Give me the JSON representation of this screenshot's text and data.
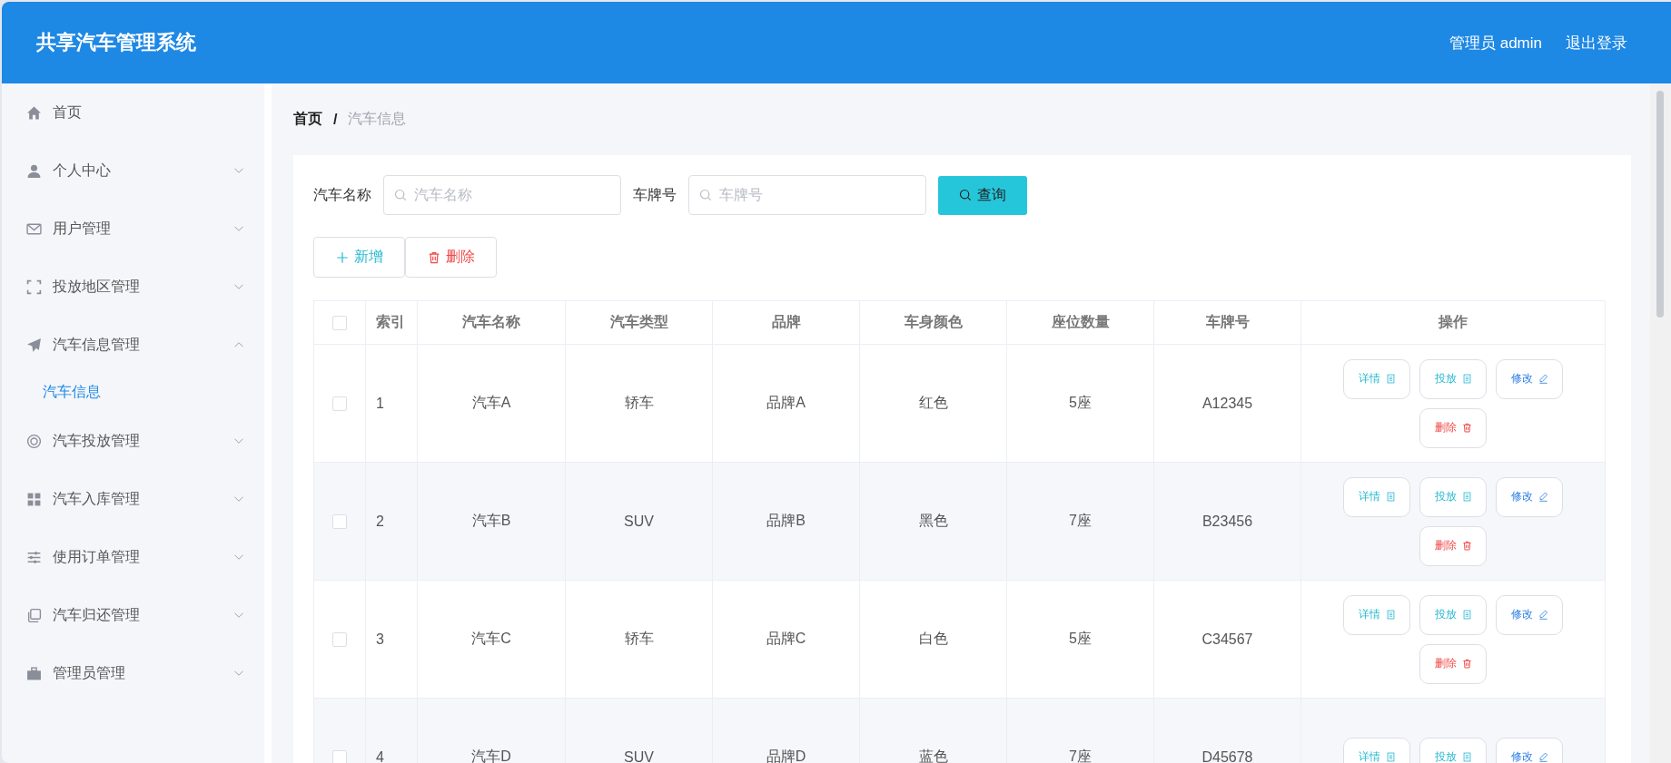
{
  "header": {
    "title": "共享汽车管理系统",
    "user": "管理员 admin",
    "logout": "退出登录"
  },
  "sidebar": {
    "items": [
      {
        "label": "首页",
        "kind": "link"
      },
      {
        "label": "个人中心",
        "kind": "menu",
        "expanded": false
      },
      {
        "label": "用户管理",
        "kind": "menu",
        "expanded": false
      },
      {
        "label": "投放地区管理",
        "kind": "menu",
        "expanded": false
      },
      {
        "label": "汽车信息管理",
        "kind": "menu",
        "expanded": true,
        "children": [
          {
            "label": "汽车信息",
            "selected": true
          }
        ]
      },
      {
        "label": "汽车投放管理",
        "kind": "menu",
        "expanded": false
      },
      {
        "label": "汽车入库管理",
        "kind": "menu",
        "expanded": false
      },
      {
        "label": "使用订单管理",
        "kind": "menu",
        "expanded": false
      },
      {
        "label": "汽车归还管理",
        "kind": "menu",
        "expanded": false
      },
      {
        "label": "管理员管理",
        "kind": "menu",
        "expanded": false
      }
    ]
  },
  "breadcrumb": {
    "items": [
      "首页",
      "汽车信息"
    ],
    "separator": "/"
  },
  "search": {
    "fields": [
      {
        "label": "汽车名称",
        "placeholder": "汽车名称"
      },
      {
        "label": "车牌号",
        "placeholder": "车牌号"
      }
    ],
    "button": "查询"
  },
  "toolbar": [
    {
      "label": "新增",
      "kind": "add"
    },
    {
      "label": "删除",
      "kind": "delete"
    }
  ],
  "table": {
    "select_all": {
      "checked": false
    },
    "columns": [
      "索引",
      "汽车名称",
      "汽车类型",
      "品牌",
      "车身颜色",
      "座位数量",
      "车牌号",
      "操作"
    ],
    "rows": [
      {
        "checked": false,
        "cells": [
          "1",
          "汽车A",
          "轿车",
          "品牌A",
          "红色",
          "5座",
          "A12345"
        ],
        "actions": [
          {
            "label": "详情",
            "kind": "detail"
          },
          {
            "label": "投放",
            "kind": "dispatch"
          },
          {
            "label": "修改",
            "kind": "edit"
          },
          {
            "label": "删除",
            "kind": "delete"
          }
        ]
      },
      {
        "checked": false,
        "cells": [
          "2",
          "汽车B",
          "SUV",
          "品牌B",
          "黑色",
          "7座",
          "B23456"
        ],
        "actions": [
          {
            "label": "详情",
            "kind": "detail"
          },
          {
            "label": "投放",
            "kind": "dispatch"
          },
          {
            "label": "修改",
            "kind": "edit"
          },
          {
            "label": "删除",
            "kind": "delete"
          }
        ]
      },
      {
        "checked": false,
        "cells": [
          "3",
          "汽车C",
          "轿车",
          "品牌C",
          "白色",
          "5座",
          "C34567"
        ],
        "actions": [
          {
            "label": "详情",
            "kind": "detail"
          },
          {
            "label": "投放",
            "kind": "dispatch"
          },
          {
            "label": "修改",
            "kind": "edit"
          },
          {
            "label": "删除",
            "kind": "delete"
          }
        ]
      },
      {
        "checked": false,
        "cells": [
          "4",
          "汽车D",
          "SUV",
          "品牌D",
          "蓝色",
          "7座",
          "D45678"
        ],
        "actions": [
          {
            "label": "详情",
            "kind": "detail"
          },
          {
            "label": "投放",
            "kind": "dispatch"
          },
          {
            "label": "修改",
            "kind": "edit"
          }
        ]
      }
    ]
  }
}
